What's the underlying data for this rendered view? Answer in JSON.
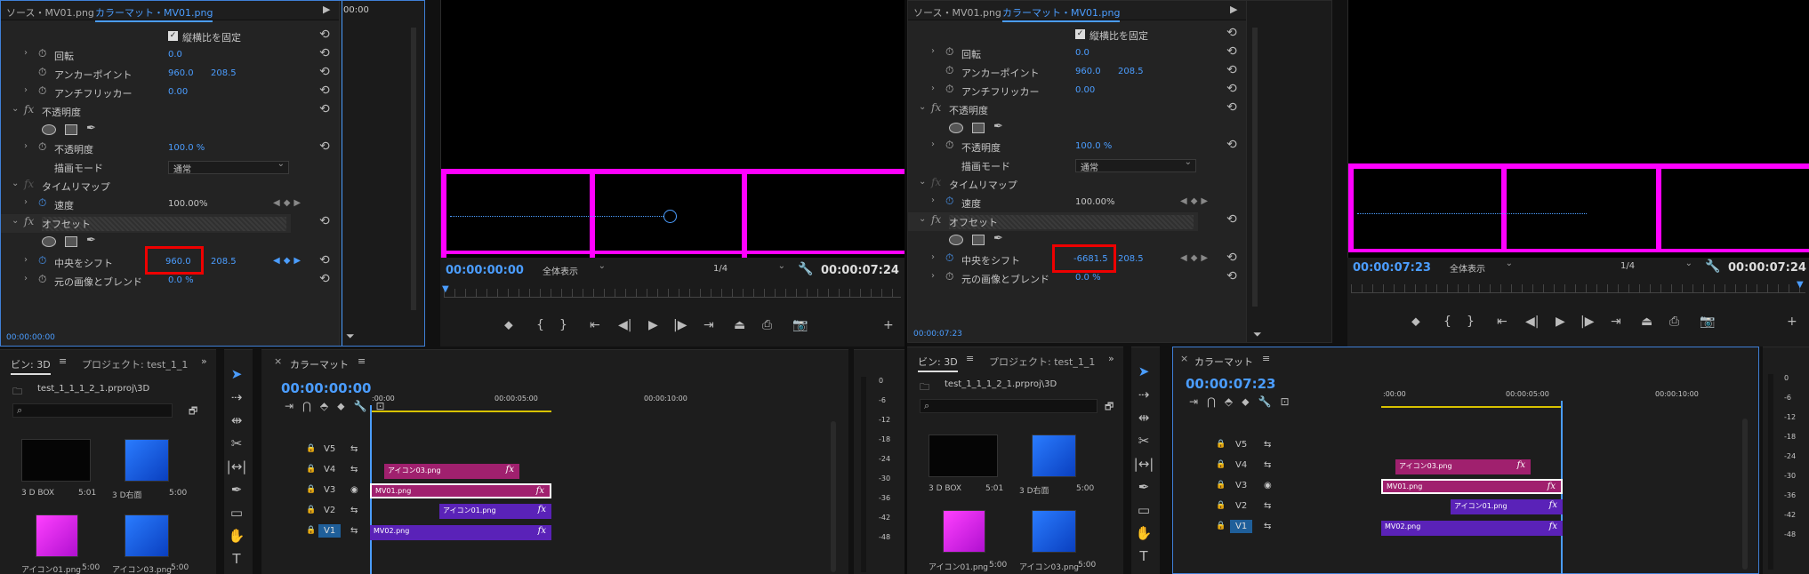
{
  "left": {
    "tabs": {
      "source": "ソース・MV01.png",
      "active": "カラーマット・MV01.png"
    },
    "mini_timecode": "00:00",
    "effect_controls": {
      "lock_aspect_label": "縦横比を固定",
      "rotation": {
        "label": "回転",
        "value": "0.0"
      },
      "anchor": {
        "label": "アンカーポイント",
        "x": "960.0",
        "y": "208.5"
      },
      "antiflicker": {
        "label": "アンチフリッカー",
        "value": "0.00"
      },
      "opacity_section": "不透明度",
      "opacity": {
        "label": "不透明度",
        "value": "100.0 %"
      },
      "blend_mode": {
        "label": "描画モード",
        "value": "通常"
      },
      "time_remap_section": "タイムリマップ",
      "speed": {
        "label": "速度",
        "value": "100.00%"
      },
      "offset_section": "オフセット",
      "shift_center": {
        "label": "中央をシフト",
        "x": "960.0",
        "y": "208.5"
      },
      "blend_original": {
        "label": "元の画像とブレンド",
        "value": "0.0 %"
      },
      "bottom_timecode": "00:00:00:00"
    },
    "program": {
      "timecode": "00:00:00:00",
      "zoom": "全体表示",
      "resolution": "1/4",
      "duration": "00:00:07:24"
    },
    "bins": {
      "tab_bin": "ビン: 3D",
      "tab_project": "プロジェクト: test_1_1",
      "path": "test_1_1_1_2_1.prproj\\3D",
      "items": [
        {
          "name": "3 D BOX",
          "dur": "5:01"
        },
        {
          "name": "3 D右面",
          "dur": "5:00"
        },
        {
          "name": "アイコン01.png",
          "dur": "5:00"
        },
        {
          "name": "アイコン03.png",
          "dur": "5:00"
        }
      ]
    },
    "timeline": {
      "tab": "カラーマット",
      "timecode": "00:00:00:00",
      "ruler": [
        ":00:00",
        "00:00:05:00",
        "00:00:10:00"
      ],
      "tracks": [
        "V5",
        "V4",
        "V3",
        "V2",
        "V1"
      ],
      "clips": {
        "v4": "アイコン03.png",
        "v3": "MV01.png",
        "v2": "アイコン01.png",
        "v1": "MV02.png"
      }
    }
  },
  "right": {
    "tabs": {
      "source": "ソース・MV01.png",
      "active": "カラーマット・MV01.png"
    },
    "effect_controls": {
      "lock_aspect_label": "縦横比を固定",
      "rotation": {
        "label": "回転",
        "value": "0.0"
      },
      "anchor": {
        "label": "アンカーポイント",
        "x": "960.0",
        "y": "208.5"
      },
      "antiflicker": {
        "label": "アンチフリッカー",
        "value": "0.00"
      },
      "opacity_section": "不透明度",
      "opacity": {
        "label": "不透明度",
        "value": "100.0 %"
      },
      "blend_mode": {
        "label": "描画モード",
        "value": "通常"
      },
      "time_remap_section": "タイムリマップ",
      "speed": {
        "label": "速度",
        "value": "100.00%"
      },
      "offset_section": "オフセット",
      "shift_center": {
        "label": "中央をシフト",
        "x": "-6681.5",
        "y": "208.5"
      },
      "blend_original": {
        "label": "元の画像とブレンド",
        "value": "0.0 %"
      },
      "bottom_timecode": "00:00:07:23"
    },
    "program": {
      "timecode": "00:00:07:23",
      "zoom": "全体表示",
      "resolution": "1/4",
      "duration": "00:00:07:24"
    },
    "bins": {
      "tab_bin": "ビン: 3D",
      "tab_project": "プロジェクト: test_1_1",
      "path": "test_1_1_1_2_1.prproj\\3D",
      "items": [
        {
          "name": "3 D BOX",
          "dur": "5:01"
        },
        {
          "name": "3 D右面",
          "dur": "5:00"
        },
        {
          "name": "アイコン01.png",
          "dur": "5:00"
        },
        {
          "name": "アイコン03.png",
          "dur": "5:00"
        }
      ]
    },
    "timeline": {
      "tab": "カラーマット",
      "timecode": "00:00:07:23",
      "ruler": [
        ":00:00",
        "00:00:05:00",
        "00:00:10:00"
      ],
      "tracks": [
        "V5",
        "V4",
        "V3",
        "V2",
        "V1"
      ],
      "clips": {
        "v4": "アイコン03.png",
        "v3": "MV01.png",
        "v2": "アイコン01.png",
        "v1": "MV02.png"
      }
    }
  },
  "meter_scale": [
    "0",
    "-6",
    "-12",
    "-18",
    "-24",
    "-30",
    "-36",
    "-42",
    "-48"
  ],
  "colors": {
    "accent": "#4b9dff",
    "magenta": "#ff00ff",
    "clip_pink": "#a0206e",
    "clip_violet": "#5a22b8",
    "red_box": "#e00000"
  }
}
